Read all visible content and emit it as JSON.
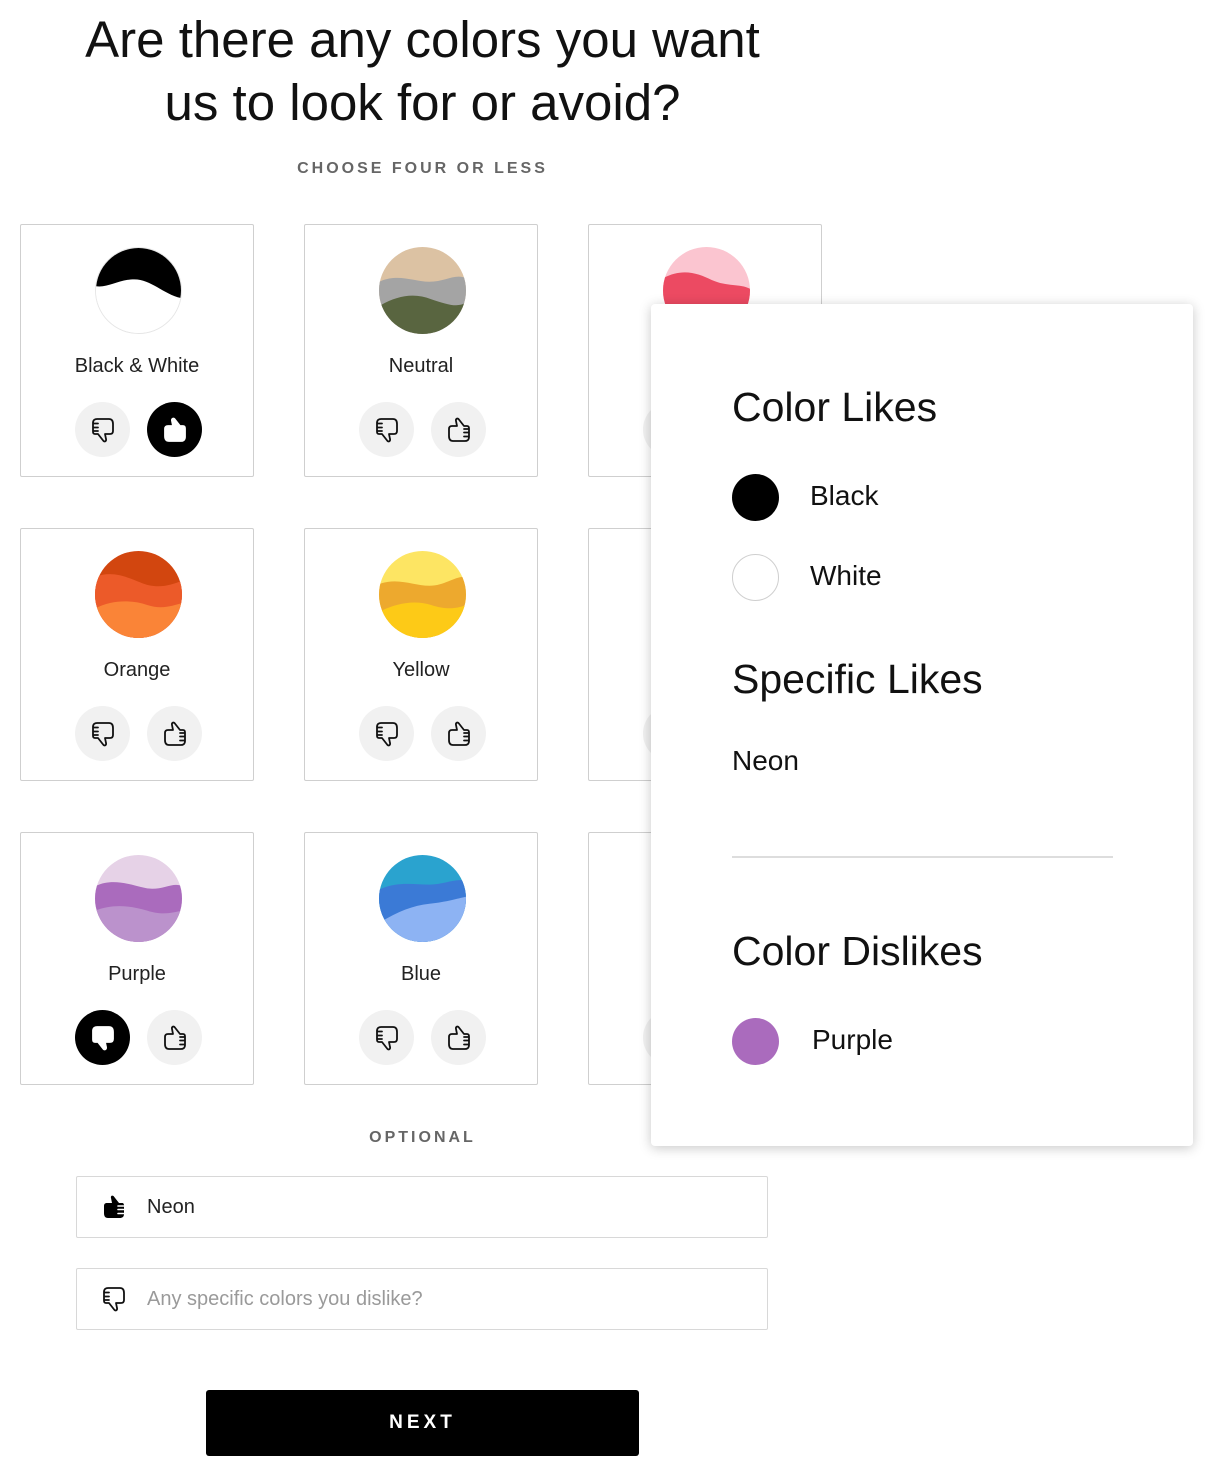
{
  "heading": {
    "line1": "Are there any colors you want",
    "line2": "us to look for or avoid?"
  },
  "subtitle": "CHOOSE FOUR OR LESS",
  "cards": [
    {
      "label": "Black & White",
      "selection": "like"
    },
    {
      "label": "Neutral",
      "selection": "none"
    },
    {
      "label": "",
      "selection": "none"
    },
    {
      "label": "Orange",
      "selection": "none"
    },
    {
      "label": "Yellow",
      "selection": "none"
    },
    {
      "label": "",
      "selection": "none"
    },
    {
      "label": "Purple",
      "selection": "dislike"
    },
    {
      "label": "Blue",
      "selection": "none"
    },
    {
      "label": "",
      "selection": "none"
    }
  ],
  "optional_label": "OPTIONAL",
  "likes_field": {
    "value": "Neon",
    "icon": "thumbs-up-filled-icon"
  },
  "dislikes_field": {
    "value": "",
    "placeholder": "Any specific colors you dislike?",
    "icon": "thumbs-down-outline-icon"
  },
  "next_label": "NEXT",
  "summary": {
    "color_likes_title": "Color Likes",
    "color_likes": [
      {
        "name": "Black",
        "color": "#000000"
      },
      {
        "name": "White",
        "color": "#ffffff"
      }
    ],
    "specific_likes_title": "Specific Likes",
    "specific_likes": [
      "Neon"
    ],
    "color_dislikes_title": "Color Dislikes",
    "color_dislikes": [
      {
        "name": "Purple",
        "color": "#aa6bbd"
      }
    ]
  },
  "colors": {
    "accent": "#000000",
    "vote_bg": "#f1f1f1",
    "card_border": "#cfcfcf"
  }
}
